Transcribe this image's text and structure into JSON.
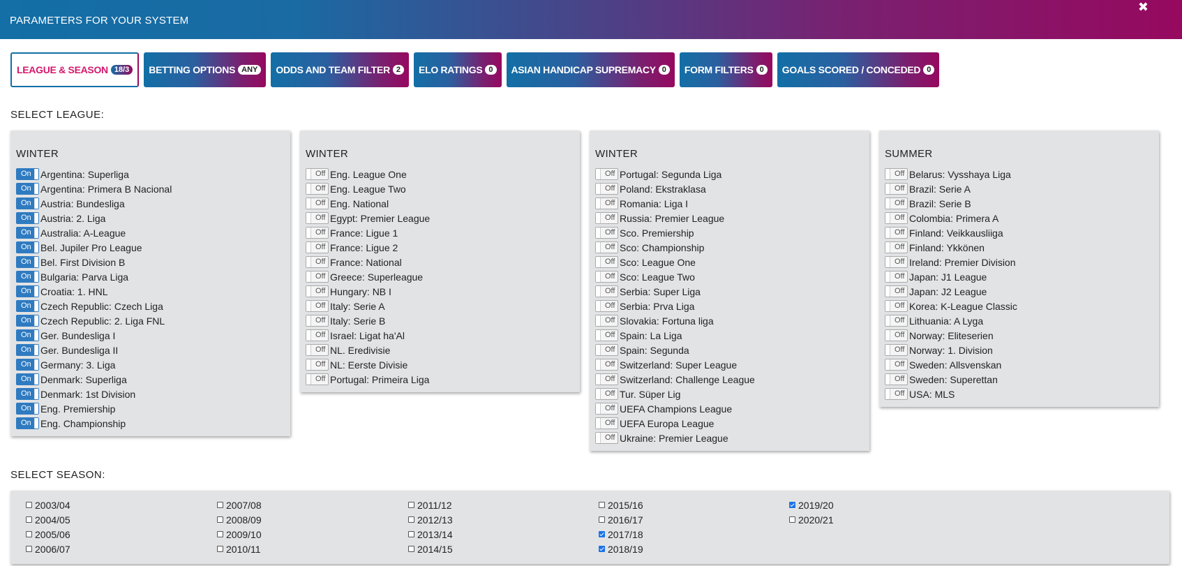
{
  "header": {
    "title": "PARAMETERS FOR YOUR SYSTEM",
    "close_glyph": "✖"
  },
  "tabs": [
    {
      "label": "LEAGUE & SEASON",
      "badge": "18/3",
      "active": true
    },
    {
      "label": "BETTING OPTIONS",
      "badge": "ANY",
      "active": false
    },
    {
      "label": "ODDS AND TEAM FILTER",
      "badge": "2",
      "active": false
    },
    {
      "label": "ELO RATINGS",
      "badge": "0",
      "active": false
    },
    {
      "label": "ASIAN HANDICAP SUPREMACY",
      "badge": "0",
      "active": false
    },
    {
      "label": "FORM FILTERS",
      "badge": "0",
      "active": false
    },
    {
      "label": "GOALS SCORED / CONCEDED",
      "badge": "0",
      "active": false
    }
  ],
  "select_league_label": "SELECT LEAGUE:",
  "select_season_label": "SELECT SEASON:",
  "toggle_labels": {
    "on": "On",
    "off": "Off"
  },
  "league_groups": [
    {
      "title": "WINTER",
      "leagues": [
        {
          "name": "Argentina: Superliga",
          "on": true
        },
        {
          "name": "Argentina: Primera B Nacional",
          "on": true
        },
        {
          "name": "Austria: Bundesliga",
          "on": true
        },
        {
          "name": "Austria: 2. Liga",
          "on": true
        },
        {
          "name": "Australia: A-League",
          "on": true
        },
        {
          "name": "Bel. Jupiler Pro League",
          "on": true
        },
        {
          "name": "Bel. First Division B",
          "on": true
        },
        {
          "name": "Bulgaria: Parva Liga",
          "on": true
        },
        {
          "name": "Croatia: 1. HNL",
          "on": true
        },
        {
          "name": "Czech Republic: Czech Liga",
          "on": true
        },
        {
          "name": "Czech Republic: 2. Liga FNL",
          "on": true
        },
        {
          "name": "Ger. Bundesliga I",
          "on": true
        },
        {
          "name": "Ger. Bundesliga II",
          "on": true
        },
        {
          "name": "Germany: 3. Liga",
          "on": true
        },
        {
          "name": "Denmark: Superliga",
          "on": true
        },
        {
          "name": "Denmark: 1st Division",
          "on": true
        },
        {
          "name": "Eng. Premiership",
          "on": true
        },
        {
          "name": "Eng. Championship",
          "on": true
        }
      ]
    },
    {
      "title": "WINTER",
      "leagues": [
        {
          "name": "Eng. League One",
          "on": false
        },
        {
          "name": "Eng. League Two",
          "on": false
        },
        {
          "name": "Eng. National",
          "on": false
        },
        {
          "name": "Egypt: Premier League",
          "on": false
        },
        {
          "name": "France: Ligue 1",
          "on": false
        },
        {
          "name": "France: Ligue 2",
          "on": false
        },
        {
          "name": "France: National",
          "on": false
        },
        {
          "name": "Greece: Superleague",
          "on": false
        },
        {
          "name": "Hungary: NB I",
          "on": false
        },
        {
          "name": "Italy: Serie A",
          "on": false
        },
        {
          "name": "Italy: Serie B",
          "on": false
        },
        {
          "name": "Israel: Ligat ha'Al",
          "on": false
        },
        {
          "name": "NL. Eredivisie",
          "on": false
        },
        {
          "name": "NL: Eerste Divisie",
          "on": false
        },
        {
          "name": "Portugal: Primeira Liga",
          "on": false
        }
      ]
    },
    {
      "title": "WINTER",
      "leagues": [
        {
          "name": "Portugal: Segunda Liga",
          "on": false
        },
        {
          "name": "Poland: Ekstraklasa",
          "on": false
        },
        {
          "name": "Romania: Liga I",
          "on": false
        },
        {
          "name": "Russia: Premier League",
          "on": false
        },
        {
          "name": "Sco. Premiership",
          "on": false
        },
        {
          "name": "Sco: Championship",
          "on": false
        },
        {
          "name": "Sco: League One",
          "on": false
        },
        {
          "name": "Sco: League Two",
          "on": false
        },
        {
          "name": "Serbia: Super Liga",
          "on": false
        },
        {
          "name": "Serbia: Prva Liga",
          "on": false
        },
        {
          "name": "Slovakia: Fortuna liga",
          "on": false
        },
        {
          "name": "Spain: La Liga",
          "on": false
        },
        {
          "name": "Spain: Segunda",
          "on": false
        },
        {
          "name": "Switzerland: Super League",
          "on": false
        },
        {
          "name": "Switzerland: Challenge League",
          "on": false
        },
        {
          "name": "Tur. Süper Lig",
          "on": false
        },
        {
          "name": "UEFA Champions League",
          "on": false
        },
        {
          "name": "UEFA Europa League",
          "on": false
        },
        {
          "name": "Ukraine: Premier League",
          "on": false
        }
      ]
    },
    {
      "title": "SUMMER",
      "leagues": [
        {
          "name": "Belarus: Vysshaya Liga",
          "on": false
        },
        {
          "name": "Brazil: Serie A",
          "on": false
        },
        {
          "name": "Brazil: Serie B",
          "on": false
        },
        {
          "name": "Colombia: Primera A",
          "on": false
        },
        {
          "name": "Finland: Veikkausliiga",
          "on": false
        },
        {
          "name": "Finland: Ykkönen",
          "on": false
        },
        {
          "name": "Ireland: Premier Division",
          "on": false
        },
        {
          "name": "Japan: J1 League",
          "on": false
        },
        {
          "name": "Japan: J2 League",
          "on": false
        },
        {
          "name": "Korea: K-League Classic",
          "on": false
        },
        {
          "name": "Lithuania: A Lyga",
          "on": false
        },
        {
          "name": "Norway: Eliteserien",
          "on": false
        },
        {
          "name": "Norway: 1. Division",
          "on": false
        },
        {
          "name": "Sweden: Allsvenskan",
          "on": false
        },
        {
          "name": "Sweden: Superettan",
          "on": false
        },
        {
          "name": "USA: MLS",
          "on": false
        }
      ]
    }
  ],
  "season_columns": [
    [
      {
        "label": "2003/04",
        "checked": false
      },
      {
        "label": "2004/05",
        "checked": false
      },
      {
        "label": "2005/06",
        "checked": false
      },
      {
        "label": "2006/07",
        "checked": false
      }
    ],
    [
      {
        "label": "2007/08",
        "checked": false
      },
      {
        "label": "2008/09",
        "checked": false
      },
      {
        "label": "2009/10",
        "checked": false
      },
      {
        "label": "2010/11",
        "checked": false
      }
    ],
    [
      {
        "label": "2011/12",
        "checked": false
      },
      {
        "label": "2012/13",
        "checked": false
      },
      {
        "label": "2013/14",
        "checked": false
      },
      {
        "label": "2014/15",
        "checked": false
      }
    ],
    [
      {
        "label": "2015/16",
        "checked": false
      },
      {
        "label": "2016/17",
        "checked": false
      },
      {
        "label": "2017/18",
        "checked": true
      },
      {
        "label": "2018/19",
        "checked": true
      }
    ],
    [
      {
        "label": "2019/20",
        "checked": true
      },
      {
        "label": "2020/21",
        "checked": false
      }
    ]
  ],
  "colors": {
    "gradient_start": "#136fa6",
    "gradient_end": "#96095f",
    "active_tab_text": "#d4186c",
    "toggle_on": "#2f7bc1",
    "panel_bg": "#e2e3e5"
  }
}
